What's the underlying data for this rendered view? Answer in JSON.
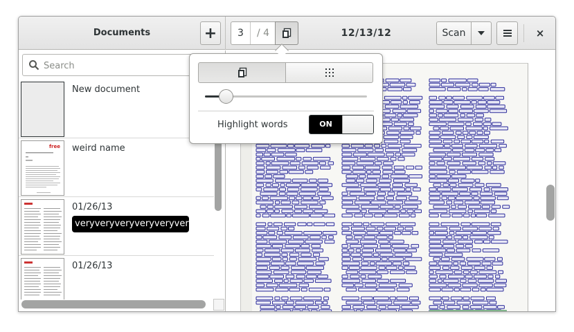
{
  "headerbar": {
    "sidebar_title": "Documents",
    "add_label": "+",
    "page_current": "3",
    "page_total": "/ 4",
    "doc_title": "12/13/12",
    "scan_label": "Scan",
    "close_label": "×"
  },
  "sidebar": {
    "search_placeholder": "Search",
    "documents": [
      {
        "name": "New document"
      },
      {
        "name": "weird name"
      },
      {
        "name": "01/26/13",
        "edit_value": "veryveryveryveryveryveryvery"
      },
      {
        "name": "01/26/13"
      }
    ]
  },
  "popover": {
    "zoom_level": 0.13,
    "highlight_label": "Highlight words",
    "switch_on_label": "ON",
    "highlight_enabled": true
  },
  "colors": {
    "highlight_boxes": "#2b2b9a",
    "page_background": "#f7f7f4",
    "switch_on": "#000000"
  },
  "icons": {
    "add": "plus-icon",
    "page_view": "page-view-icon",
    "dropdown": "chevron-down-icon",
    "menu": "hamburger-menu-icon",
    "close": "close-icon",
    "search": "search-icon",
    "single_page": "single-page-icon",
    "grid": "grid-icon"
  }
}
